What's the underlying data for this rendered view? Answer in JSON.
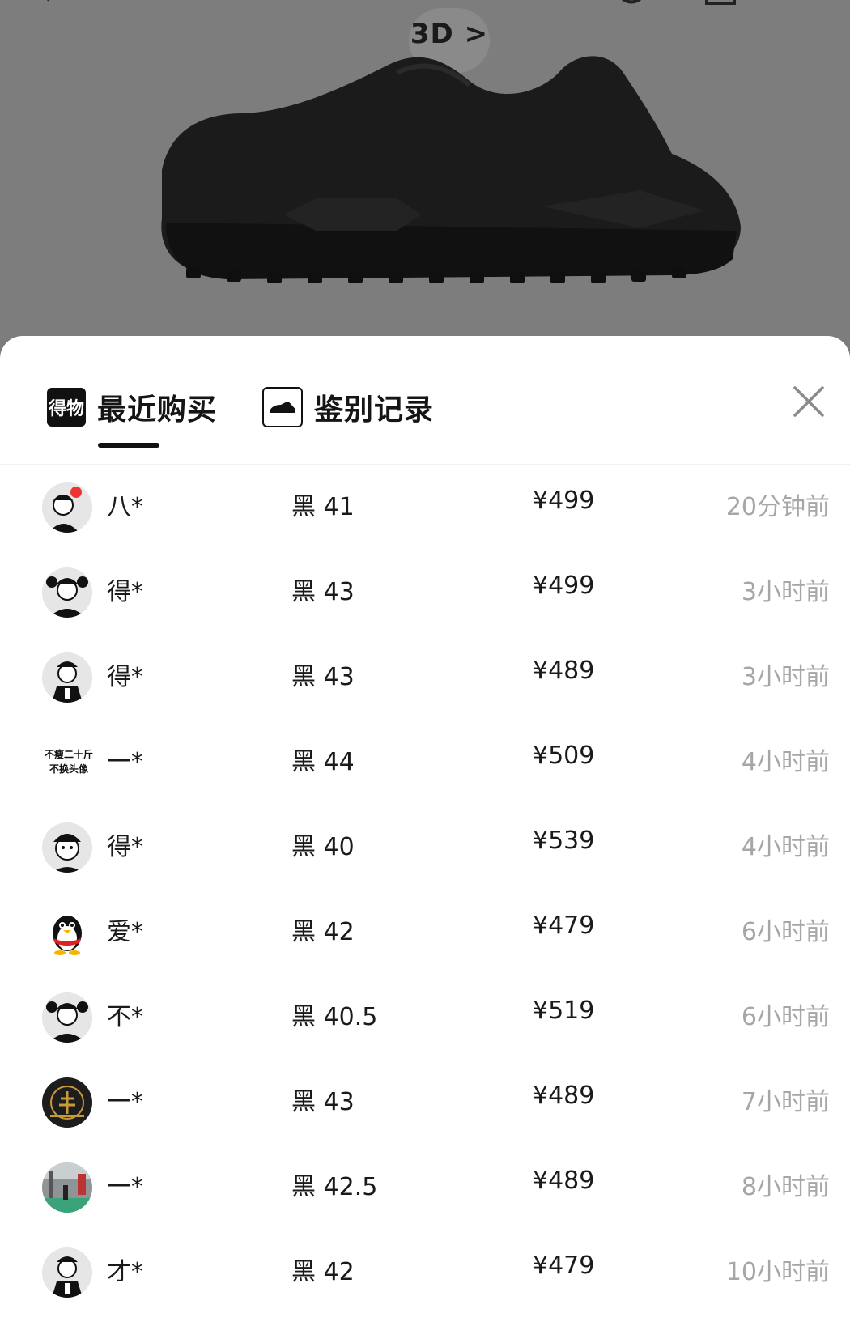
{
  "hero": {
    "badge_3d": "3D >",
    "shoe_color": "#1b1b1b"
  },
  "tabs": [
    {
      "logo_text": "得物",
      "label": "最近购买",
      "active": true
    },
    {
      "icon": "sneaker-icon",
      "label": "鉴别记录",
      "active": false
    }
  ],
  "close_icon": "close-icon",
  "records": [
    {
      "avatar": "cartoon-boy-red-flower",
      "name": "八*",
      "spec": "黑 41",
      "price": "¥499",
      "time": "20分钟前"
    },
    {
      "avatar": "cartoon-boy-fists",
      "name": "得*",
      "spec": "黑 43",
      "price": "¥499",
      "time": "3小时前"
    },
    {
      "avatar": "cartoon-boy-vest",
      "name": "得*",
      "spec": "黑 43",
      "price": "¥489",
      "time": "3小时前"
    },
    {
      "avatar_text": "不瘦二十斤 不换头像",
      "name": "一*",
      "spec": "黑 44",
      "price": "¥509",
      "time": "4小时前"
    },
    {
      "avatar": "cartoon-boy-face",
      "name": "得*",
      "spec": "黑 40",
      "price": "¥539",
      "time": "4小时前"
    },
    {
      "avatar": "qq-penguin",
      "name": "爱*",
      "spec": "黑 42",
      "price": "¥479",
      "time": "6小时前"
    },
    {
      "avatar": "cartoon-boy-fists",
      "name": "不*",
      "spec": "黑 40.5",
      "price": "¥519",
      "time": "6小时前"
    },
    {
      "avatar": "dark-gold-emblem",
      "name": "一*",
      "spec": "黑 43",
      "price": "¥489",
      "time": "7小时前"
    },
    {
      "avatar": "street-photo",
      "name": "一*",
      "spec": "黑 42.5",
      "price": "¥489",
      "time": "8小时前"
    },
    {
      "avatar": "cartoon-boy-vest",
      "name": "才*",
      "spec": "黑 42",
      "price": "¥479",
      "time": "10小时前"
    }
  ]
}
